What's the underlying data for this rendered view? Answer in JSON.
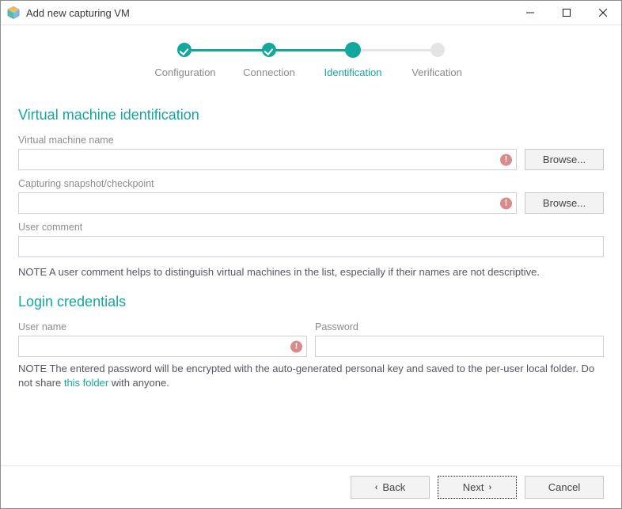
{
  "window": {
    "title": "Add new capturing VM"
  },
  "stepper": {
    "steps": [
      "Configuration",
      "Connection",
      "Identification",
      "Verification"
    ],
    "current_index": 2
  },
  "sections": {
    "identification": {
      "heading": "Virtual machine identification",
      "vm_name": {
        "label": "Virtual machine name",
        "value": "",
        "browse": "Browse..."
      },
      "snapshot": {
        "label": "Capturing snapshot/checkpoint",
        "value": "",
        "browse": "Browse..."
      },
      "comment": {
        "label": "User comment",
        "value": ""
      },
      "note": "NOTE A user comment helps to distinguish virtual machines in the list, especially if their names are not descriptive."
    },
    "login": {
      "heading": "Login credentials",
      "username": {
        "label": "User name",
        "value": ""
      },
      "password": {
        "label": "Password",
        "value": ""
      },
      "note_pre": "NOTE The entered password will be encrypted with the auto-generated personal key and saved to the per-user local folder. Do not share ",
      "note_link": "this folder",
      "note_post": " with anyone."
    }
  },
  "footer": {
    "back": "Back",
    "next": "Next",
    "cancel": "Cancel"
  },
  "icons": {
    "app": "app-icon",
    "minimize": "minimize-icon",
    "maximize": "maximize-icon",
    "close": "close-icon",
    "error": "error-icon",
    "chev_left": "‹",
    "chev_right": "›"
  }
}
